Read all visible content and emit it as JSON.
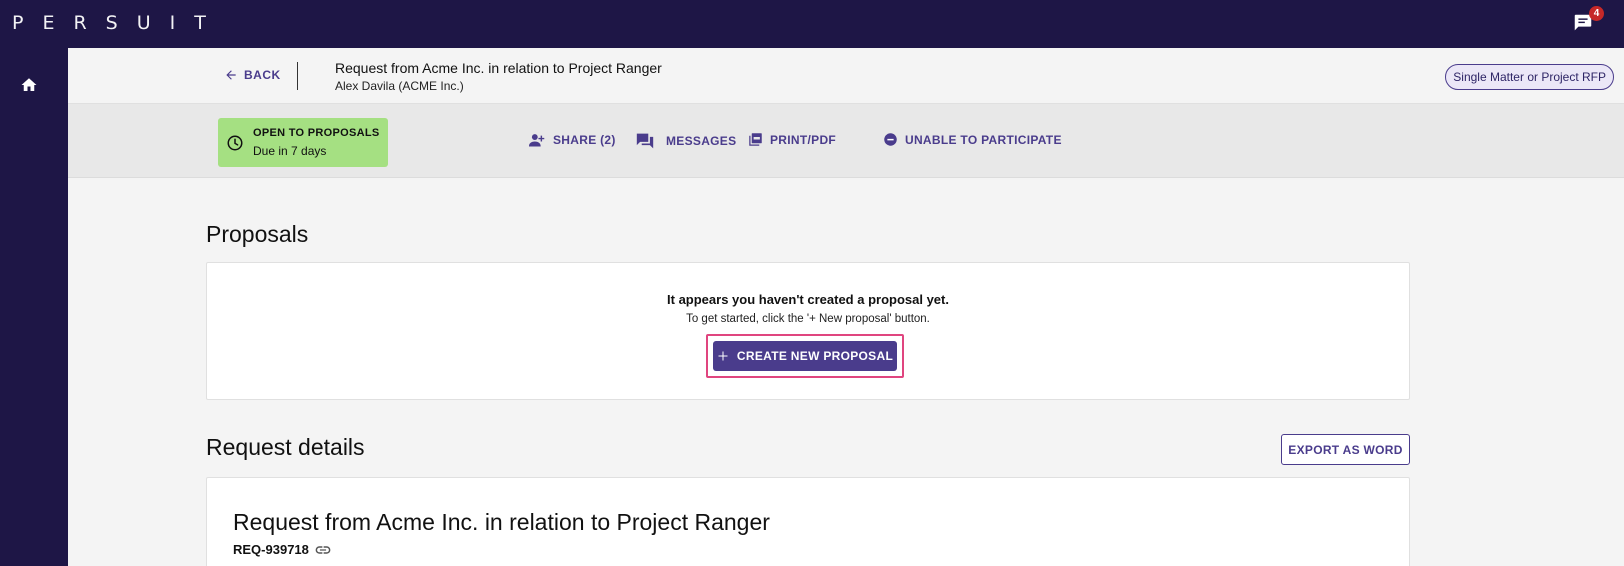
{
  "topbar": {
    "logo": "PERSUIT",
    "notification_count": "4"
  },
  "header": {
    "back_label": "BACK",
    "request_title": "Request from Acme Inc. in relation to Project Ranger",
    "requester": "Alex Davila (ACME Inc.)",
    "rfp_type": "Single Matter or Project RFP"
  },
  "actionbar": {
    "status_title": "OPEN TO PROPOSALS",
    "status_due": "Due in 7 days",
    "share_label": "SHARE (2)",
    "messages_label": "MESSAGES",
    "print_label": "PRINT/PDF",
    "unable_label": "UNABLE TO PARTICIPATE"
  },
  "proposals": {
    "heading": "Proposals",
    "empty_title": "It appears you haven't created a proposal yet.",
    "empty_subtitle": "To get started, click the '+ New proposal' button.",
    "create_label": "CREATE NEW PROPOSAL"
  },
  "details": {
    "heading": "Request details",
    "export_label": "EXPORT AS WORD",
    "title": "Request from Acme Inc. in relation to Project Ranger",
    "request_id": "REQ-939718"
  },
  "colors": {
    "nav_bg": "#1e1646",
    "accent": "#4a3c8c",
    "status_green": "#a5e082",
    "highlight": "#e0457f"
  }
}
